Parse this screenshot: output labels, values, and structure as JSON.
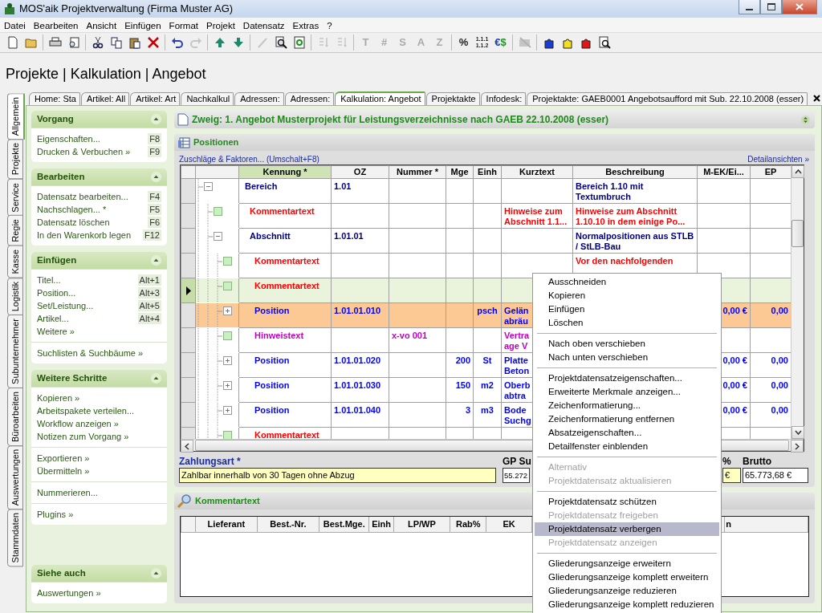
{
  "window": {
    "title": "MOS'aik Projektverwaltung (Firma Muster AG)"
  },
  "menu": [
    "Datei",
    "Bearbeiten",
    "Ansicht",
    "Einfügen",
    "Format",
    "Projekt",
    "Datensatz",
    "Extras",
    "?"
  ],
  "toolbar": [
    {
      "kind": "new",
      "disabled": false
    },
    {
      "kind": "open",
      "disabled": false
    },
    {
      "kind": "sep"
    },
    {
      "kind": "print",
      "disabled": false
    },
    {
      "kind": "preview",
      "disabled": false
    },
    {
      "kind": "sep"
    },
    {
      "kind": "cut",
      "disabled": false
    },
    {
      "kind": "copy",
      "disabled": false
    },
    {
      "kind": "paste",
      "disabled": false
    },
    {
      "kind": "delete",
      "disabled": false
    },
    {
      "kind": "sep"
    },
    {
      "kind": "undo",
      "disabled": false
    },
    {
      "kind": "redo",
      "disabled": true
    },
    {
      "kind": "sep"
    },
    {
      "kind": "up",
      "disabled": false
    },
    {
      "kind": "down",
      "disabled": false
    },
    {
      "kind": "sep"
    },
    {
      "kind": "pen",
      "disabled": true
    },
    {
      "kind": "find",
      "disabled": false
    },
    {
      "kind": "refresh",
      "disabled": false
    },
    {
      "kind": "sep"
    },
    {
      "kind": "sort",
      "disabled": true
    },
    {
      "kind": "sort",
      "disabled": true
    },
    {
      "kind": "sep"
    },
    {
      "kind": "letter",
      "label": "T",
      "disabled": true
    },
    {
      "kind": "letter",
      "label": "#",
      "disabled": true
    },
    {
      "kind": "letter",
      "label": "S",
      "disabled": true
    },
    {
      "kind": "letter",
      "label": "A",
      "disabled": true
    },
    {
      "kind": "letter",
      "label": "Z",
      "disabled": true
    },
    {
      "kind": "sep"
    },
    {
      "kind": "letter",
      "label": "%",
      "disabled": false
    },
    {
      "kind": "stack",
      "lines": [
        "1.1.1",
        "1.1.2"
      ],
      "disabled": false
    },
    {
      "kind": "currency",
      "label": "€$",
      "disabled": false
    },
    {
      "kind": "sep"
    },
    {
      "kind": "hide",
      "disabled": true
    },
    {
      "kind": "sep"
    },
    {
      "kind": "puzzle",
      "color": "#1a3fcf",
      "disabled": false
    },
    {
      "kind": "puzzle",
      "color": "#f0e020",
      "disabled": false
    },
    {
      "kind": "puzzle",
      "color": "#e01818",
      "disabled": false
    },
    {
      "kind": "docsearch",
      "disabled": false
    }
  ],
  "heading": "Projekte | Kalkulation | Angebot",
  "side_tabs": [
    {
      "label": "Allgemein",
      "selected": true
    },
    {
      "label": "Projekte",
      "selected": false
    },
    {
      "label": "Service",
      "selected": false
    },
    {
      "label": "Regie",
      "selected": false
    },
    {
      "label": "Kasse",
      "selected": false
    },
    {
      "label": "Logistik",
      "selected": false
    },
    {
      "label": "Subunternehmer",
      "selected": false
    },
    {
      "label": "Büroarbeiten",
      "selected": false
    },
    {
      "label": "Auswertungen",
      "selected": false
    },
    {
      "label": "Stammdaten",
      "selected": false
    }
  ],
  "doc_tabs": [
    {
      "label": "Home: Sta",
      "selected": false
    },
    {
      "label": "Artikel: All",
      "selected": false
    },
    {
      "label": "Artikel: Art",
      "selected": false
    },
    {
      "label": "Nachkalkul",
      "selected": false
    },
    {
      "label": "Adressen:",
      "selected": false
    },
    {
      "label": "Adressen:",
      "selected": false
    },
    {
      "label": "Kalkulation: Angebot",
      "selected": true
    },
    {
      "label": "Projektakte",
      "selected": false
    },
    {
      "label": "Infodesk: ",
      "selected": false
    },
    {
      "label": "Projektakte: GAEB0001 Angebotsaufford mit Sub. 22.10.2008 (esser)",
      "selected": false
    }
  ],
  "task_panel": [
    {
      "title": "Vorgang",
      "expanded": true,
      "groups": [
        [
          {
            "label": "Eigenschaften...",
            "shortcut": "F8"
          },
          {
            "label": "Drucken & Verbuchen »",
            "shortcut": "F9"
          }
        ]
      ]
    },
    {
      "title": "Bearbeiten",
      "expanded": true,
      "groups": [
        [
          {
            "label": "Datensatz bearbeiten...",
            "shortcut": "F4"
          },
          {
            "label": "Nachschlagen... *",
            "shortcut": "F5"
          },
          {
            "label": "Datensatz löschen",
            "shortcut": "F6"
          },
          {
            "label": "In den Warenkorb legen",
            "shortcut": "F12"
          }
        ]
      ]
    },
    {
      "title": "Einfügen",
      "expanded": true,
      "groups": [
        [
          {
            "label": "Titel...",
            "shortcut": "Alt+1"
          },
          {
            "label": "Position...",
            "shortcut": "Alt+3"
          },
          {
            "label": "Set/Leistung...",
            "shortcut": "Alt+5"
          },
          {
            "label": "Artikel...",
            "shortcut": "Alt+4"
          },
          {
            "label": "Weitere »"
          }
        ],
        [
          {
            "label": "Suchlisten & Suchbäume »"
          }
        ]
      ]
    },
    {
      "title": "Weitere Schritte",
      "expanded": true,
      "groups": [
        [
          {
            "label": "Kopieren »"
          },
          {
            "label": "Arbeitspakete verteilen..."
          },
          {
            "label": "Workflow anzeigen »"
          },
          {
            "label": "Notizen zum Vorgang »"
          }
        ],
        [
          {
            "label": "Exportieren »"
          },
          {
            "label": "Übermitteln »"
          }
        ],
        [
          {
            "label": "Nummerieren..."
          }
        ],
        [
          {
            "label": "Plugins »"
          }
        ]
      ]
    },
    {
      "title": "Siehe auch",
      "expanded": true,
      "groups": [
        [
          {
            "label": "Auswertungen »"
          }
        ]
      ]
    }
  ],
  "branch": "Zweig: 1. Angebot Musterprojekt für Leistungsverzeichnisse nach GAEB 22.10.2008 (esser)",
  "positions": {
    "title": "Positionen",
    "link_left": "Zuschläge & Faktoren... (Umschalt+F8)",
    "link_right": "Detailansichten »",
    "columns": [
      {
        "label": "Kennung *",
        "selected": true
      },
      {
        "label": "OZ",
        "selected": false
      },
      {
        "label": "Nummer *",
        "selected": false
      },
      {
        "label": "Mge",
        "selected": false
      },
      {
        "label": "Einh",
        "selected": false
      },
      {
        "label": "Kurztext",
        "selected": false
      },
      {
        "label": "Beschreibung",
        "selected": false
      },
      {
        "label": "M-EK/Ei...",
        "selected": false
      },
      {
        "label": "EP",
        "selected": false
      }
    ],
    "rows": [
      {
        "kind": "group",
        "kennung": "Bereich",
        "oz": "1.01",
        "beschreibung": "Bereich 1.10 mit Textumbruch",
        "expanded": true,
        "selected": false,
        "marked": false,
        "children": [
          {
            "kind": "comment",
            "kennung": "Kommentartext",
            "kurztext": "Hinweise zum Abschnitt 1.1...",
            "beschreibung": "Hinweise zum Abschnitt 1.10.10 in dem einige Po...",
            "selected": false,
            "marked": false
          },
          {
            "kind": "group",
            "kennung": "Abschnitt",
            "oz": "1.01.01",
            "beschreibung": "Normalpositionen aus STLB / StLB-Bau",
            "expanded": true,
            "selected": false,
            "marked": false,
            "children": [
              {
                "kind": "comment",
                "kennung": "Kommentartext",
                "beschreibung": "Vor den nachfolgenden",
                "selected": false,
                "marked": false
              },
              {
                "kind": "comment",
                "kennung": "Kommentartext",
                "selected": true,
                "marked": false
              },
              {
                "kind": "position",
                "kennung": "Position",
                "oz": "1.01.01.010",
                "einh": "psch",
                "kurztext": "Gelän\nabräu",
                "mek": "0,00 €",
                "ep": "0,00",
                "expanded": false,
                "selected": false,
                "marked": true
              },
              {
                "kind": "note",
                "kennung": "Hinweistext",
                "nummer": "x-vo 001",
                "kurztext": "Vertra\nage V",
                "selected": false,
                "marked": false
              },
              {
                "kind": "position",
                "kennung": "Position",
                "oz": "1.01.01.020",
                "mge": "200",
                "einh": "St",
                "kurztext": "Platte\nBeton",
                "mek": "0,00 €",
                "ep": "0,00",
                "expanded": false,
                "selected": false,
                "marked": false
              },
              {
                "kind": "position",
                "kennung": "Position",
                "oz": "1.01.01.030",
                "mge": "150",
                "einh": "m2",
                "kurztext": "Oberb\nabtra",
                "mek": "0,00 €",
                "ep": "0,00",
                "expanded": false,
                "selected": false,
                "marked": false
              },
              {
                "kind": "position",
                "kennung": "Position",
                "oz": "1.01.01.040",
                "mge": "3",
                "einh": "m3",
                "kurztext": "Bode\nSuchg",
                "mek": "0,00 €",
                "ep": "0,00",
                "expanded": false,
                "selected": false,
                "marked": false
              },
              {
                "kind": "comment",
                "kennung": "Kommentartext",
                "selected": false,
                "marked": false
              }
            ]
          }
        ]
      }
    ]
  },
  "totals": {
    "payment_label": "Zahlungsart *",
    "payment_value": "Zahlbar innerhalb von 30 Tagen ohne Abzug",
    "gp_label": "GP Su",
    "gp_value": "55.272",
    "pct_label": "%",
    "pct_value": "€",
    "brutto_label": "Brutto",
    "brutto_value": "65.773,68 €"
  },
  "comment_panel": {
    "title": "Kommentartext",
    "columns": [
      "Lieferant",
      "Best.-Nr.",
      "Best.Mge.",
      "Einh",
      "LP/WP",
      "Rab%",
      "EK"
    ],
    "column_9": "n"
  },
  "context_menu": [
    {
      "kind": "item",
      "label": "Ausschneiden",
      "disabled": false,
      "selected": false
    },
    {
      "kind": "item",
      "label": "Kopieren",
      "disabled": false,
      "selected": false
    },
    {
      "kind": "item",
      "label": "Einfügen",
      "disabled": false,
      "selected": false
    },
    {
      "kind": "item",
      "label": "Löschen",
      "disabled": false,
      "selected": false
    },
    {
      "kind": "sep"
    },
    {
      "kind": "item",
      "label": "Nach oben verschieben",
      "disabled": false,
      "selected": false
    },
    {
      "kind": "item",
      "label": "Nach unten verschieben",
      "disabled": false,
      "selected": false
    },
    {
      "kind": "sep"
    },
    {
      "kind": "item",
      "label": "Projektdatensatzeigenschaften...",
      "disabled": false,
      "selected": false
    },
    {
      "kind": "item",
      "label": "Erweiterte Merkmale anzeigen...",
      "disabled": false,
      "selected": false
    },
    {
      "kind": "item",
      "label": "Zeichenformatierung...",
      "disabled": false,
      "selected": false
    },
    {
      "kind": "item",
      "label": "Zeichenformatierung entfernen",
      "disabled": false,
      "selected": false
    },
    {
      "kind": "item",
      "label": "Absatzeigenschaften...",
      "disabled": false,
      "selected": false
    },
    {
      "kind": "item",
      "label": "Detailfenster einblenden",
      "disabled": false,
      "selected": false
    },
    {
      "kind": "sep"
    },
    {
      "kind": "item",
      "label": "Alternativ",
      "disabled": true,
      "selected": false
    },
    {
      "kind": "item",
      "label": "Projektdatensatz aktualisieren",
      "disabled": true,
      "selected": false
    },
    {
      "kind": "sep"
    },
    {
      "kind": "item",
      "label": "Projektdatensatz schützen",
      "disabled": false,
      "selected": false
    },
    {
      "kind": "item",
      "label": "Projektdatensatz freigeben",
      "disabled": true,
      "selected": false
    },
    {
      "kind": "item",
      "label": "Projektdatensatz verbergen",
      "disabled": false,
      "selected": true
    },
    {
      "kind": "item",
      "label": "Projektdatensatz anzeigen",
      "disabled": true,
      "selected": false
    },
    {
      "kind": "sep"
    },
    {
      "kind": "item",
      "label": "Gliederungsanzeige erweitern",
      "disabled": false,
      "selected": false
    },
    {
      "kind": "item",
      "label": "Gliederungsanzeige komplett erweitern",
      "disabled": false,
      "selected": false
    },
    {
      "kind": "item",
      "label": "Gliederungsanzeige reduzieren",
      "disabled": false,
      "selected": false
    },
    {
      "kind": "item",
      "label": "Gliederungsanzeige komplett reduzieren",
      "disabled": false,
      "selected": false
    }
  ]
}
